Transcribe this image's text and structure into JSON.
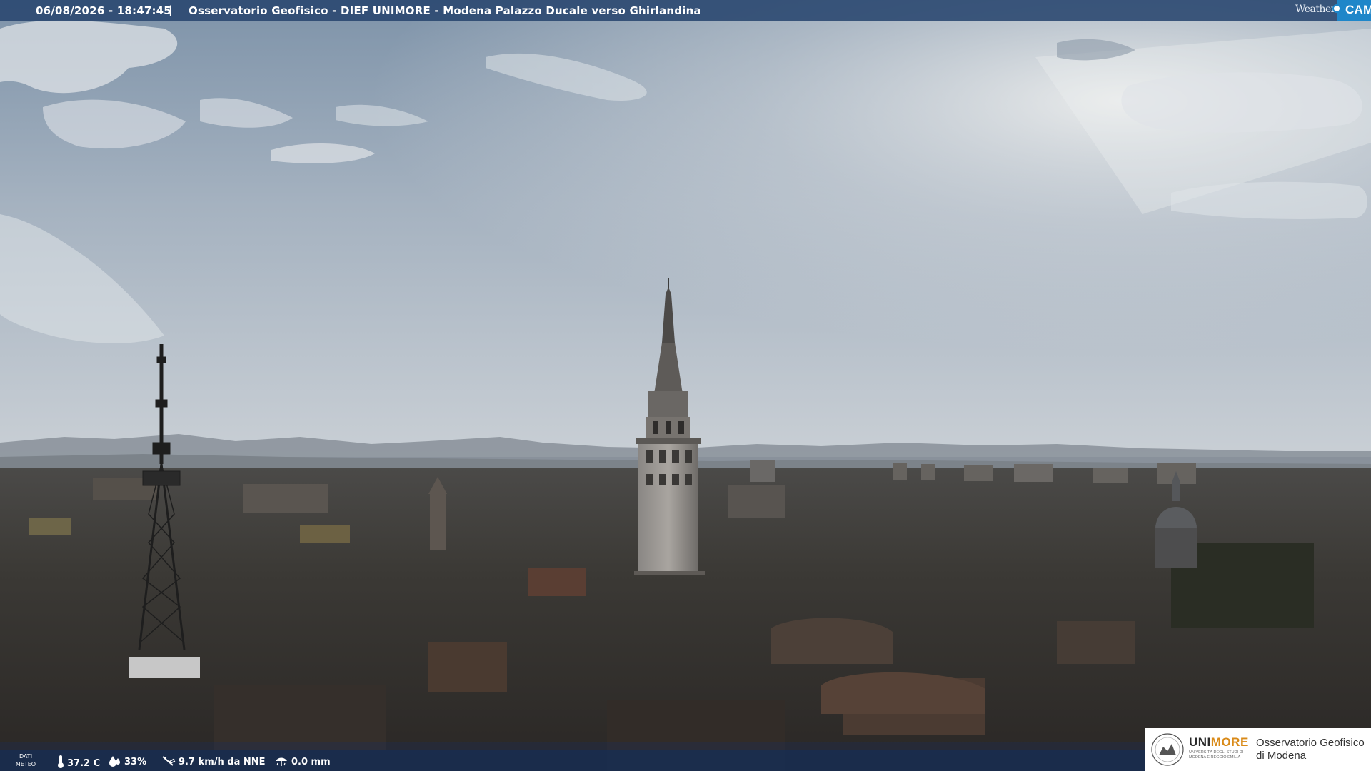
{
  "overlay": {
    "timestamp": "06/08/2026 - 18:47:45",
    "separator": "|",
    "caption": "Osservatorio Geofisico - DIEF UNIMORE - Modena Palazzo Ducale verso Ghirlandina"
  },
  "brand": {
    "weather": "Weather",
    "cam": "CAM",
    "accent": "#1f86c9"
  },
  "weather_bar": {
    "label_line1": "DATI",
    "label_line2": "METEO",
    "temperature": "37.2 C",
    "humidity": "33%",
    "wind": "9.7 km/h da NNE",
    "rain": "0.0 mm",
    "icons": [
      "thermometer-icon",
      "humidity-drop-icon",
      "wind-vane-icon",
      "rain-gauge-icon"
    ]
  },
  "logo": {
    "uni": "UNI",
    "more": "MORE",
    "uni_sub_line1": "UNIVERSITÀ DEGLI STUDI DI",
    "uni_sub_line2": "MODENA E REGGIO EMILIA",
    "observatory_line1": "Osservatorio Geofisico",
    "observatory_line2": "di Modena"
  }
}
